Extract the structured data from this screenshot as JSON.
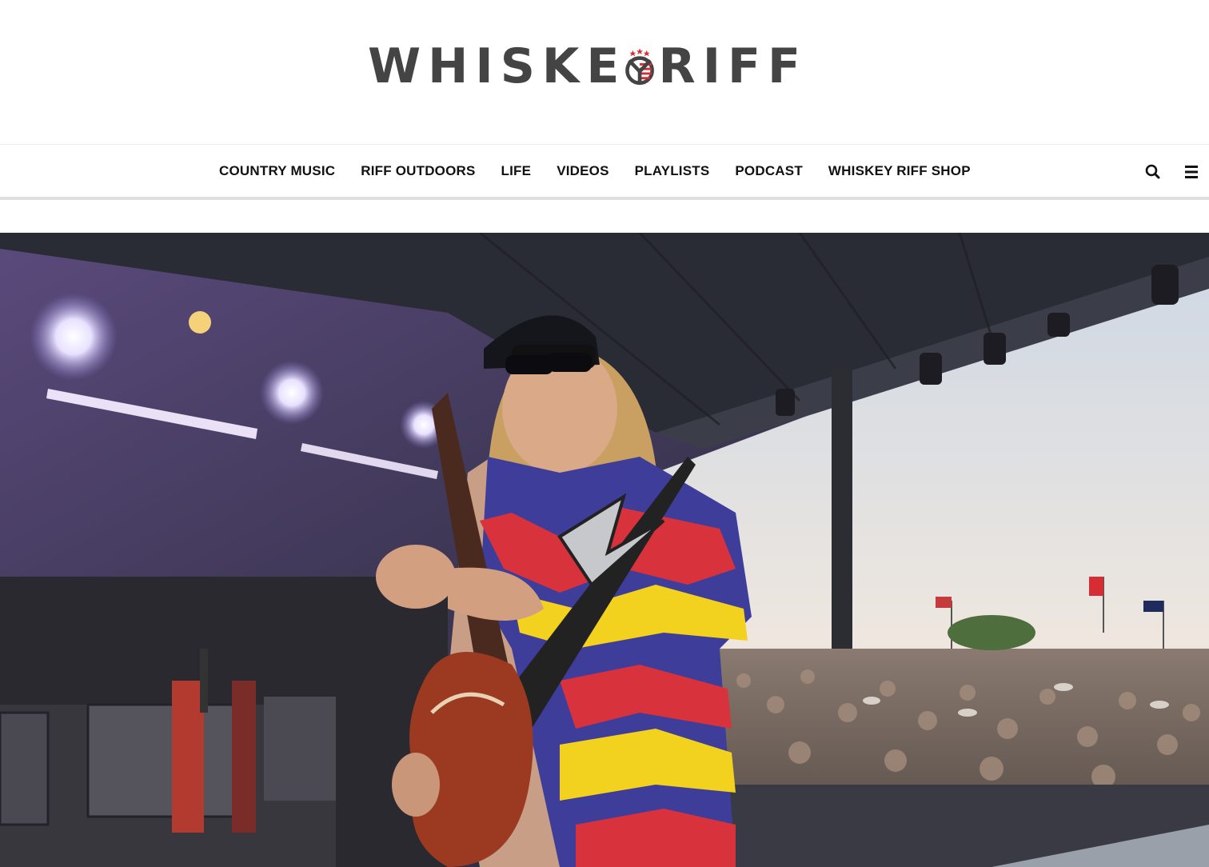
{
  "site": {
    "logo_text_left": "WHISKE",
    "logo_text_right": "RIFF",
    "logo_alt": "WHISKEY RIFF"
  },
  "nav": {
    "items": [
      {
        "label": "COUNTRY MUSIC"
      },
      {
        "label": "RIFF OUTDOORS"
      },
      {
        "label": "LIFE"
      },
      {
        "label": "VIDEOS"
      },
      {
        "label": "PLAYLISTS"
      },
      {
        "label": "PODCAST"
      },
      {
        "label": "WHISKEY RIFF SHOP"
      }
    ],
    "search_icon": "search-icon",
    "menu_icon": "hamburger-menu-icon"
  },
  "hero": {
    "image_description_icon": "concert-photo",
    "colors": {
      "sky": "#dfe3ea",
      "stage_roof": "#2b2d35",
      "shirt_red": "#d8323c",
      "shirt_blue": "#3f3d9a",
      "shirt_yellow": "#f2d21f"
    }
  },
  "brand": {
    "logo_gray": "#444444",
    "logo_red": "#d62c33",
    "logo_navy": "#1f2b5c"
  }
}
